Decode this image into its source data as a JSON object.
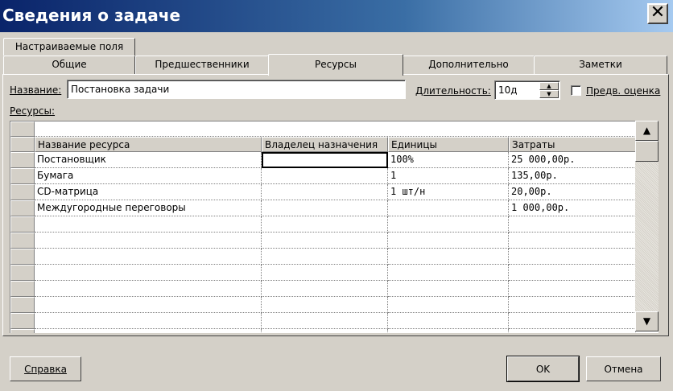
{
  "window": {
    "title": "Сведения о задаче",
    "close_glyph": "✕"
  },
  "tabs_top": [
    {
      "label": "Настраиваемые поля"
    }
  ],
  "tabs": [
    {
      "label": "Общие",
      "active": false
    },
    {
      "label": "Предшественники",
      "active": false
    },
    {
      "label": "Ресурсы",
      "active": true
    },
    {
      "label": "Дополнительно",
      "active": false
    },
    {
      "label": "Заметки",
      "active": false
    }
  ],
  "form": {
    "name_label": "Название:",
    "name_value": "Постановка задачи",
    "duration_label": "Длительность:",
    "duration_value": "10д",
    "estimate_label": "Предв. оценка",
    "estimate_checked": false,
    "resources_label": "Ресурсы:"
  },
  "grid": {
    "columns": [
      "Название ресурса",
      "Владелец назначения",
      "Единицы",
      "Затраты"
    ],
    "rows": [
      {
        "name": "Постановщик",
        "owner": "",
        "units": "100%",
        "cost": "25 000,00р."
      },
      {
        "name": "Бумага",
        "owner": "",
        "units": "1",
        "cost": "135,00р."
      },
      {
        "name": "CD-матрица",
        "owner": "",
        "units": "1 шт/н",
        "cost": "20,00р."
      },
      {
        "name": "Междугородные переговоры",
        "owner": "",
        "units": "",
        "cost": "1 000,00р."
      }
    ]
  },
  "buttons": {
    "help": "Справка",
    "ok": "OK",
    "cancel": "Отмена"
  },
  "icons": {
    "scroll_up": "▲",
    "scroll_down": "▼",
    "spin_up": "▲",
    "spin_down": "▼"
  },
  "colors": {
    "titlebar_start": "#0a246a",
    "titlebar_end": "#a6caf0",
    "face": "#d4d0c8"
  }
}
